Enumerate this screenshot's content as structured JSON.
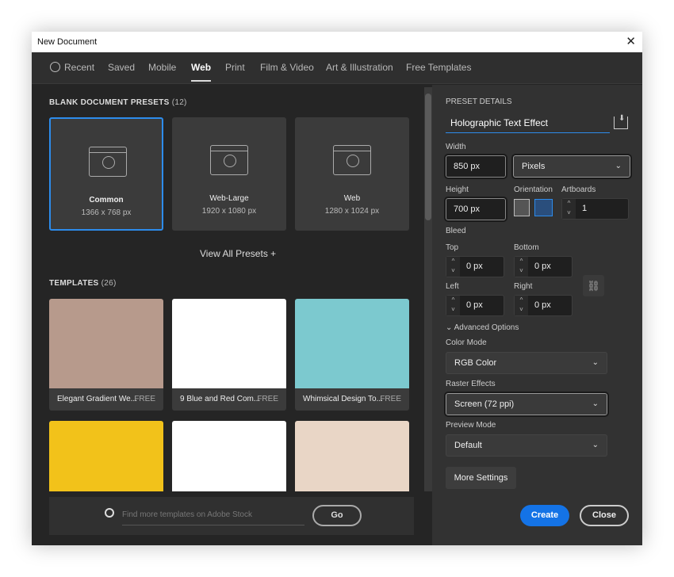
{
  "window": {
    "title": "New Document"
  },
  "tabs": [
    {
      "label": "Recent"
    },
    {
      "label": "Saved"
    },
    {
      "label": "Mobile"
    },
    {
      "label": "Web",
      "active": true
    },
    {
      "label": "Print"
    },
    {
      "label": "Film & Video"
    },
    {
      "label": "Art & Illustration"
    },
    {
      "label": "Free Templates"
    }
  ],
  "presets": {
    "heading": "BLANK DOCUMENT PRESETS",
    "count": "(12)",
    "items": [
      {
        "name": "Common",
        "dims": "1366 x 768 px",
        "selected": true
      },
      {
        "name": "Web-Large",
        "dims": "1920 x 1080 px"
      },
      {
        "name": "Web",
        "dims": "1280 x 1024 px"
      }
    ],
    "view_all": "View All Presets +"
  },
  "templates": {
    "heading": "TEMPLATES",
    "count": "(26)",
    "items": [
      {
        "name": "Elegant Gradient We...",
        "badge": "FREE",
        "color": "#b79a8c"
      },
      {
        "name": "9 Blue and Red Com...",
        "badge": "FREE",
        "color": "#ffffff"
      },
      {
        "name": "Whimsical Design To...",
        "badge": "FREE",
        "color": "#7cc9cf"
      }
    ],
    "row2_colors": [
      "#f2c21a",
      "#ffffff",
      "#e9d6c6"
    ]
  },
  "search": {
    "placeholder": "Find more templates on Adobe Stock",
    "go_label": "Go"
  },
  "preset_details": {
    "heading": "PRESET DETAILS",
    "name": "Holographic Text Effect",
    "width_label": "Width",
    "width": "850 px",
    "units": "Pixels",
    "height_label": "Height",
    "height": "700 px",
    "orientation_label": "Orientation",
    "artboards_label": "Artboards",
    "artboards": "1",
    "bleed_label": "Bleed",
    "top_label": "Top",
    "top": "0 px",
    "bottom_label": "Bottom",
    "bottom": "0 px",
    "left_label": "Left",
    "left": "0 px",
    "right_label": "Right",
    "right": "0 px",
    "advanced_label": "Advanced Options",
    "color_mode_label": "Color Mode",
    "color_mode": "RGB Color",
    "raster_label": "Raster Effects",
    "raster": "Screen (72 ppi)",
    "preview_label": "Preview Mode",
    "preview": "Default",
    "more_settings": "More Settings"
  },
  "actions": {
    "create": "Create",
    "close": "Close"
  },
  "colors": {
    "accent": "#1473e6",
    "selection": "#2d8ceb"
  }
}
